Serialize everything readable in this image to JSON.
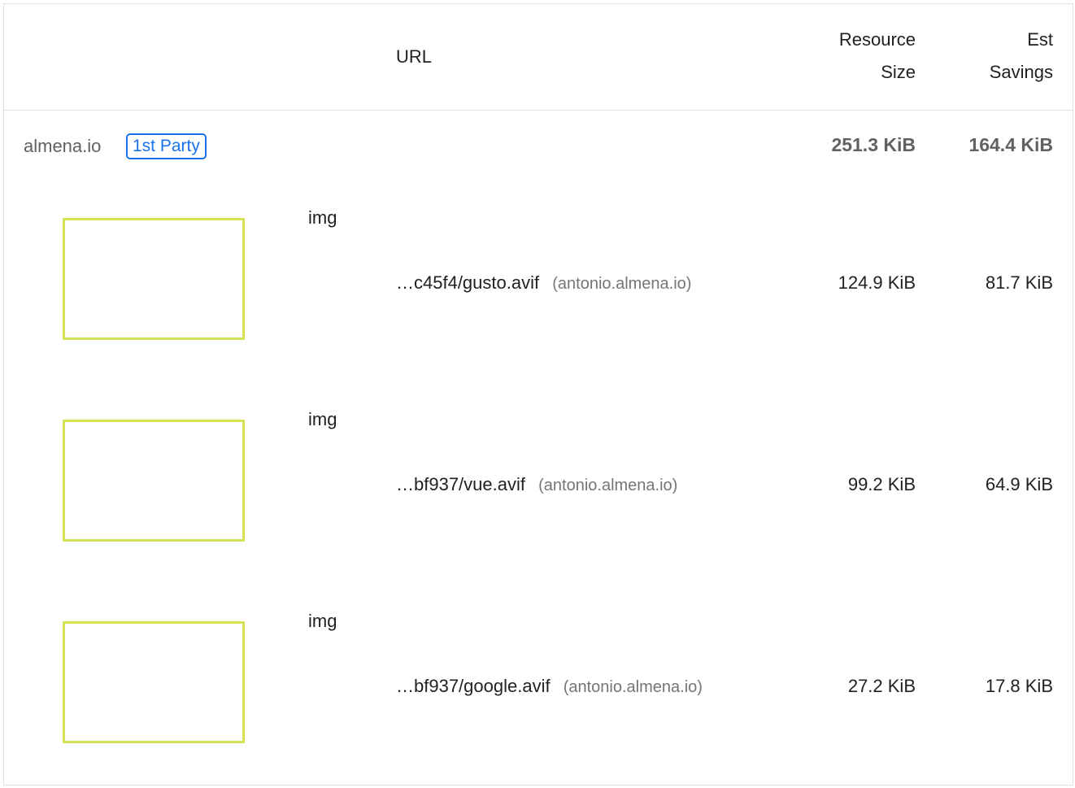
{
  "header": {
    "url_label": "URL",
    "size_label_line1": "Resource",
    "size_label_line2": "Size",
    "savings_label_line1": "Est",
    "savings_label_line2": "Savings"
  },
  "group": {
    "name": "almena.io",
    "badge": "1st Party",
    "size": "251.3 KiB",
    "savings": "164.4 KiB"
  },
  "items": [
    {
      "node": "img",
      "url": "…c45f4/gusto.avif",
      "host": "(antonio.almena.io)",
      "size": "124.9 KiB",
      "savings": "81.7 KiB"
    },
    {
      "node": "img",
      "url": "…bf937/vue.avif",
      "host": "(antonio.almena.io)",
      "size": "99.2 KiB",
      "savings": "64.9 KiB"
    },
    {
      "node": "img",
      "url": "…bf937/google.avif",
      "host": "(antonio.almena.io)",
      "size": "27.2 KiB",
      "savings": "17.8 KiB"
    }
  ],
  "colors": {
    "badge": "#1a73e8",
    "thumb_border": "#d4e157"
  }
}
